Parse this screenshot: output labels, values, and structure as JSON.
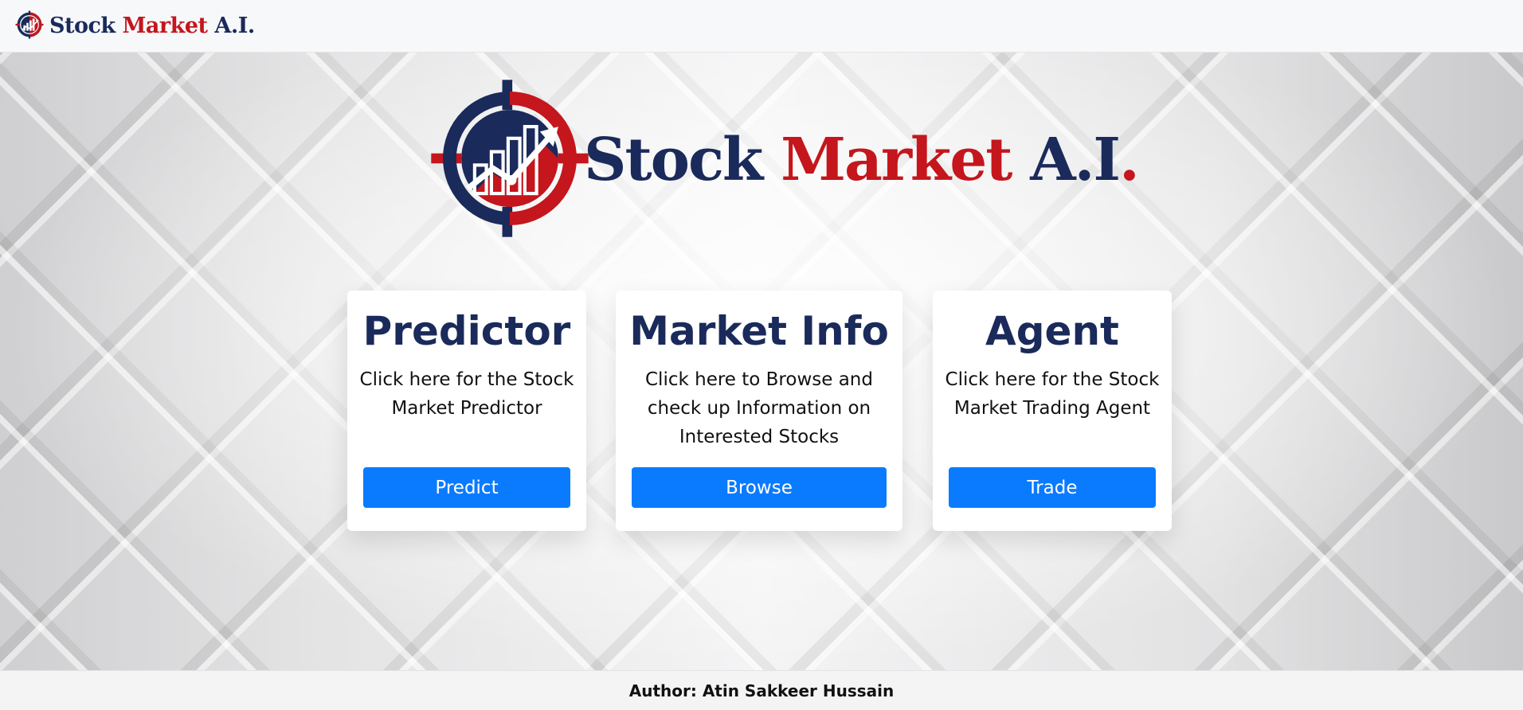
{
  "navbar": {
    "brand": {
      "word1": "Stock",
      "word2": "Market",
      "word3": "A.I.",
      "icon": "stock-chart-logo-icon"
    }
  },
  "hero": {
    "logo": {
      "word1": "Stock",
      "word2": "Market",
      "word3": "A.I",
      "word3_suffix": ".",
      "icon": "stock-chart-logo-icon"
    }
  },
  "cards": [
    {
      "title": "Predictor",
      "text": "Click here for the Stock Market Predictor",
      "button": "Predict"
    },
    {
      "title": "Market Info",
      "text": "Click here to Browse and check up Information on Interested Stocks",
      "button": "Browse"
    },
    {
      "title": "Agent",
      "text": "Click here for the Stock Market Trading Agent",
      "button": "Trade"
    }
  ],
  "footer": {
    "text": "Author: Atin Sakkeer Hussain"
  },
  "colors": {
    "navy": "#1a2a5a",
    "red": "#c4161c",
    "button": "#0a7bff"
  }
}
